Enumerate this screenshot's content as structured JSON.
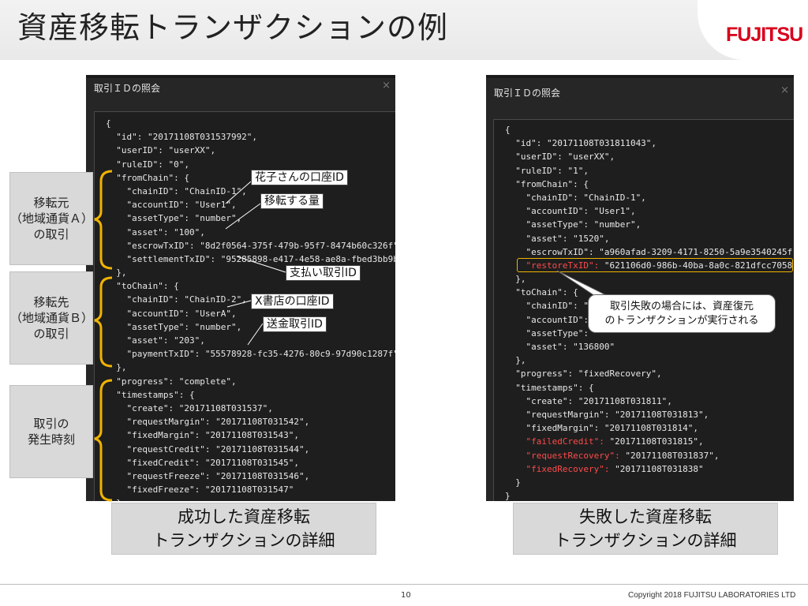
{
  "slide": {
    "title": "資産移転トランザクションの例",
    "logo": "FUJITSU",
    "page_number": "10",
    "copyright": "Copyright 2018 FUJITSU LABORATORIES LTD"
  },
  "left_panel": {
    "title": "取引ＩＤの照会",
    "close": "×",
    "lines": [
      "{",
      "  \"id\": \"20171108T031537992\",",
      "  \"userID\": \"userXX\",",
      "  \"ruleID\": \"0\",",
      "  \"fromChain\": {",
      "    \"chainID\": \"ChainID-1\",",
      "    \"accountID\": \"User1\",",
      "    \"assetType\": \"number\",",
      "    \"asset\": \"100\",",
      "    \"escrowTxID\": \"8d2f0564-375f-479b-95f7-8474b60c326f\",",
      "    \"settlementTxID\": \"95285898-e417-4e58-ae8a-fbed3bb9b\"",
      "  },",
      "  \"toChain\": {",
      "    \"chainID\": \"ChainID-2\",",
      "    \"accountID\": \"UserA\",",
      "    \"assetType\": \"number\",",
      "    \"asset\": \"203\",",
      "    \"paymentTxID\": \"55578928-fc35-4276-80c9-97d90c1287f\"",
      "  },",
      "  \"progress\": \"complete\",",
      "  \"timestamps\": {",
      "    \"create\": \"20171108T031537\",",
      "    \"requestMargin\": \"20171108T031542\",",
      "    \"fixedMargin\": \"20171108T031543\",",
      "    \"requestCredit\": \"20171108T031544\",",
      "    \"fixedCredit\": \"20171108T031545\",",
      "    \"requestFreeze\": \"20171108T031546\",",
      "    \"fixedFreeze\": \"20171108T031547\"",
      "  }",
      "}"
    ]
  },
  "right_panel": {
    "title": "取引ＩＤの照会",
    "close": "×",
    "lines": [
      "{",
      "  \"id\": \"20171108T031811043\",",
      "  \"userID\": \"userXX\",",
      "  \"ruleID\": \"1\",",
      "  \"fromChain\": {",
      "    \"chainID\": \"ChainID-1\",",
      "    \"accountID\": \"User1\",",
      "    \"assetType\": \"number\",",
      "    \"asset\": \"1520\",",
      "    \"escrowTxID\": \"a960afad-3209-4171-8250-5a9e3540245f\",",
      "    \"restoreTxID\": \"621106d0-986b-40ba-8a0c-821dfcc7058\"",
      "  },",
      "  \"toChain\": {",
      "    \"chainID\": \"C",
      "    \"accountID\": ",
      "    \"assetType\": ",
      "    \"asset\": \"136800\"",
      "  },",
      "  \"progress\": \"fixedRecovery\",",
      "  \"timestamps\": {",
      "    \"create\": \"20171108T031811\",",
      "    \"requestMargin\": \"20171108T031813\",",
      "    \"fixedMargin\": \"20171108T031814\",",
      "    \"failedCredit\": \"20171108T031815\",",
      "    \"requestRecovery\": \"20171108T031837\",",
      "    \"fixedRecovery\": \"20171108T031838\"",
      "  }",
      "}"
    ],
    "red_keys": [
      "\"restoreTxID\":",
      "\"failedCredit\":",
      "\"requestRecovery\":",
      "\"fixedRecovery\":"
    ]
  },
  "side_labels": [
    {
      "lines": [
        "移転元",
        "（地域通貨Ａ）",
        "の取引"
      ]
    },
    {
      "lines": [
        "移転先",
        "（地域通貨Ｂ）",
        "の取引"
      ]
    },
    {
      "lines": [
        "取引の",
        "発生時刻"
      ]
    }
  ],
  "callouts": {
    "hanako_account": "花子さんの口座ID",
    "transfer_amount": "移転する量",
    "payment_id": "支払い取引ID",
    "x_store_account": "X書店の口座ID",
    "remit_id": "送金取引ID"
  },
  "bubble": {
    "lines": [
      "取引失敗の場合には、資産復元",
      "のトランザクションが実行される"
    ]
  },
  "captions": {
    "success": [
      "成功した資産移転",
      "トランザクションの詳細"
    ],
    "failure": [
      "失敗した資産移転",
      "トランザクションの詳細"
    ]
  },
  "colors": {
    "accent_yellow": "#f0b300",
    "logo_red": "#d8001c",
    "panel_bg": "#262626",
    "failure_red": "#ff4a4a"
  }
}
